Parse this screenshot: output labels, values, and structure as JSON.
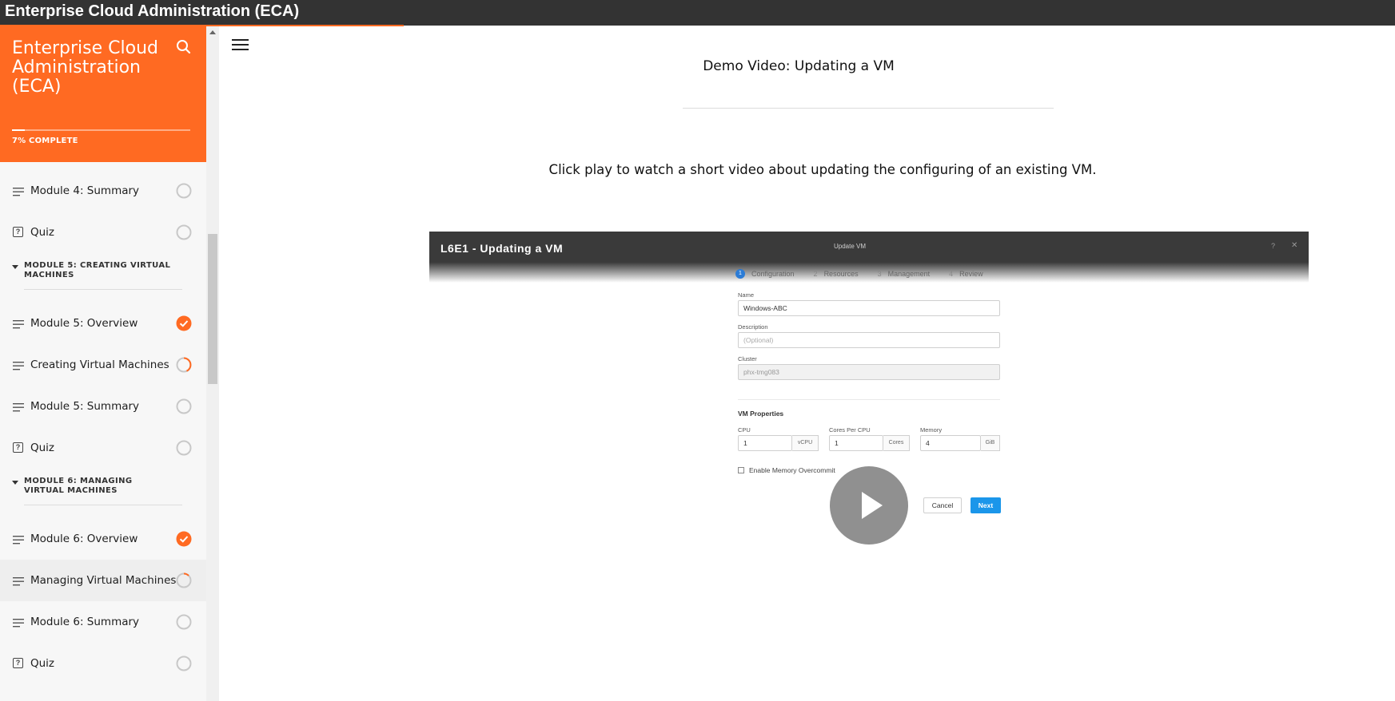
{
  "window": {
    "title": "Enterprise Cloud Administration (ECA)"
  },
  "sidebar": {
    "course_title": "Enterprise Cloud Administration (ECA)",
    "progress_percent": 7,
    "progress_label": "7% COMPLETE",
    "entries": [
      {
        "kind": "lesson",
        "label": "Module 4: Summary",
        "status": "not-started"
      },
      {
        "kind": "quiz",
        "label": "Quiz",
        "status": "not-started"
      },
      {
        "kind": "section",
        "label": "MODULE 5: CREATING VIRTUAL MACHINES"
      },
      {
        "kind": "lesson",
        "label": "Module 5: Overview",
        "status": "complete"
      },
      {
        "kind": "lesson",
        "label": "Creating Virtual Machines",
        "status": "in-progress"
      },
      {
        "kind": "lesson",
        "label": "Module 5: Summary",
        "status": "not-started"
      },
      {
        "kind": "quiz",
        "label": "Quiz",
        "status": "not-started"
      },
      {
        "kind": "section",
        "label": "MODULE 6: MANAGING VIRTUAL MACHINES"
      },
      {
        "kind": "lesson",
        "label": "Module 6: Overview",
        "status": "complete"
      },
      {
        "kind": "lesson",
        "label": "Managing Virtual Machines",
        "status": "in-progress-low",
        "active": true
      },
      {
        "kind": "lesson",
        "label": "Module 6: Summary",
        "status": "not-started"
      },
      {
        "kind": "quiz",
        "label": "Quiz",
        "status": "not-started"
      }
    ]
  },
  "main": {
    "lesson_title": "Demo Video: Updating a VM",
    "description": "Click play to watch a short video about updating the configuring of an existing VM.",
    "video": {
      "title": "L6E1 - Updating a VM",
      "dialog_title": "Update VM",
      "help_glyph": "?",
      "close_glyph": "✕",
      "steps": [
        {
          "num": "1",
          "label": "Configuration"
        },
        {
          "num": "2",
          "label": "Resources"
        },
        {
          "num": "3",
          "label": "Management"
        },
        {
          "num": "4",
          "label": "Review"
        }
      ],
      "name_label": "Name",
      "name_value": "Windows-ABC",
      "description_label": "Description",
      "description_placeholder": "(Optional)",
      "cluster_label": "Cluster",
      "cluster_value": "phx-tmg083",
      "vm_properties_label": "VM Properties",
      "cpu_label": "CPU",
      "cpu_value": "1",
      "cpu_unit": "vCPU",
      "cores_label": "Cores Per CPU",
      "cores_value": "1",
      "cores_unit": "Cores",
      "memory_label": "Memory",
      "memory_value": "4",
      "memory_unit": "GiB",
      "overcommit_label": "Enable Memory Overcommit",
      "cancel_label": "Cancel",
      "next_label": "Next"
    }
  },
  "colors": {
    "accent": "#ff6a22",
    "topbar": "#333333",
    "next_button": "#1b96ea"
  }
}
